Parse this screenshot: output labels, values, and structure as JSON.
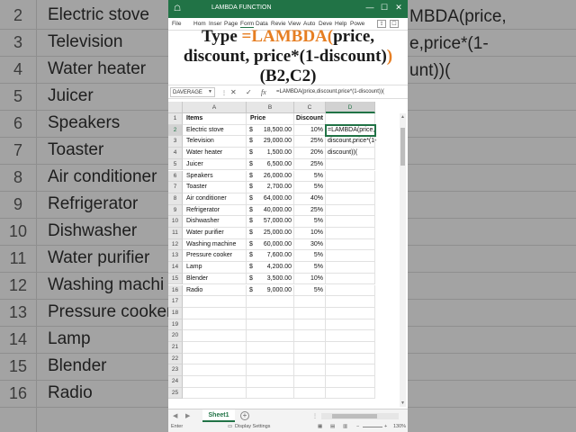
{
  "window": {
    "title": "LAMBDA FUNCTION",
    "file_icon_label": "☖",
    "minimize": "—",
    "restore": "☐",
    "close": "✕"
  },
  "ribbon": {
    "tabs": [
      "File",
      "Hom",
      "Inser",
      "Page",
      "Form",
      "Data",
      "Revie",
      "View",
      "Auto",
      "Deve",
      "Help",
      "Powe"
    ],
    "active_tab": "Form"
  },
  "overlay": {
    "line1_prefix": "Type ",
    "line1_highlight": "=LAMBDA(",
    "line1_suffix": "price,",
    "line2_main": "discount, price*(1-discount)",
    "line2_highlight": ")",
    "line3": "(B2,C2)"
  },
  "formula_bar": {
    "name_box": "DAVERAGE",
    "cancel": "✕",
    "enter": "✓",
    "fx": "fx",
    "content": "=LAMBDA(price,discount,price*(1-discount))("
  },
  "columns": [
    "A",
    "B",
    "C",
    "D"
  ],
  "rows": [
    "1",
    "2",
    "3",
    "4",
    "5",
    "6",
    "7",
    "8",
    "9",
    "10",
    "11",
    "12",
    "13",
    "14",
    "15",
    "16",
    "17",
    "18",
    "19",
    "20",
    "21",
    "22",
    "23",
    "24",
    "25"
  ],
  "headers": {
    "items": "Items",
    "price": "Price",
    "discount": "Discount"
  },
  "currency_symbol": "$",
  "table": [
    {
      "item": "Electric stove",
      "price": "18,500.00",
      "discount": "10%"
    },
    {
      "item": "Television",
      "price": "29,000.00",
      "discount": "25%"
    },
    {
      "item": "Water heater",
      "price": "1,500.00",
      "discount": "20%"
    },
    {
      "item": "Juicer",
      "price": "6,500.00",
      "discount": "25%"
    },
    {
      "item": "Speakers",
      "price": "26,000.00",
      "discount": "5%"
    },
    {
      "item": "Toaster",
      "price": "2,700.00",
      "discount": "5%"
    },
    {
      "item": "Air conditioner",
      "price": "64,000.00",
      "discount": "40%"
    },
    {
      "item": "Refrigerator",
      "price": "40,000.00",
      "discount": "25%"
    },
    {
      "item": "Dishwasher",
      "price": "57,000.00",
      "discount": "5%"
    },
    {
      "item": "Water purifier",
      "price": "25,000.00",
      "discount": "10%"
    },
    {
      "item": "Washing machine",
      "price": "60,000.00",
      "discount": "30%"
    },
    {
      "item": "Pressure cooker",
      "price": "7,600.00",
      "discount": "5%"
    },
    {
      "item": "Lamp",
      "price": "4,200.00",
      "discount": "5%"
    },
    {
      "item": "Blender",
      "price": "3,500.00",
      "discount": "10%"
    },
    {
      "item": "Radio",
      "price": "9,000.00",
      "discount": "5%"
    }
  ],
  "active_cell": {
    "ref": "D2",
    "lines": [
      "=LAMBDA(price,",
      "discount,price*(1-",
      "discount))("
    ]
  },
  "sheet_tabs": {
    "active": "Sheet1",
    "add": "+"
  },
  "status": {
    "mode": "Enter",
    "display_settings": "Display Settings",
    "zoom": "130%"
  },
  "background": {
    "left_rows": [
      {
        "num": "2",
        "text": "Electric stove"
      },
      {
        "num": "3",
        "text": "Television"
      },
      {
        "num": "4",
        "text": "Water heater"
      },
      {
        "num": "5",
        "text": "Juicer"
      },
      {
        "num": "6",
        "text": "Speakers"
      },
      {
        "num": "7",
        "text": "Toaster"
      },
      {
        "num": "8",
        "text": "Air conditioner"
      },
      {
        "num": "9",
        "text": "Refrigerator"
      },
      {
        "num": "10",
        "text": "Dishwasher"
      },
      {
        "num": "11",
        "text": "Water purifier"
      },
      {
        "num": "12",
        "text": "Washing machi"
      },
      {
        "num": "13",
        "text": "Pressure cooker"
      },
      {
        "num": "14",
        "text": "Lamp"
      },
      {
        "num": "15",
        "text": "Blender"
      },
      {
        "num": "16",
        "text": "Radio"
      }
    ],
    "right_lines": [
      "MBDA(price,",
      "e,price*(1-",
      "unt))("
    ]
  },
  "colors": {
    "excel_green": "#217346",
    "overlay_highlight": "#e67e22"
  }
}
